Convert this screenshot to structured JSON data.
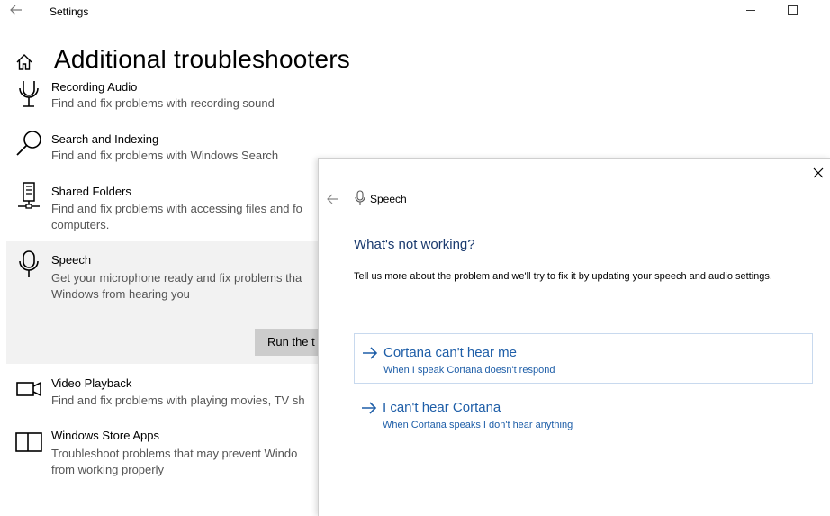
{
  "window": {
    "title": "Settings"
  },
  "page": {
    "title": "Additional troubleshooters"
  },
  "items": [
    {
      "name": "Recording Audio",
      "desc": "Find and fix problems with recording sound",
      "icon": "microphone-icon"
    },
    {
      "name": "Search and Indexing",
      "desc": "Find and fix problems with Windows Search",
      "icon": "search-icon"
    },
    {
      "name": "Shared Folders",
      "desc": "Find and fix problems with accessing files and fo computers.",
      "icon": "shared-folders-icon"
    },
    {
      "name": "Speech",
      "desc": "Get your microphone ready and fix problems tha Windows from hearing you",
      "icon": "microphone-icon",
      "run_label": "Run the t"
    },
    {
      "name": "Video Playback",
      "desc": "Find and fix problems with playing movies, TV sh",
      "icon": "video-camera-icon"
    },
    {
      "name": "Windows Store Apps",
      "desc": "Troubleshoot problems that may prevent Windo from working properly",
      "icon": "store-apps-icon"
    }
  ],
  "dialog": {
    "title": "Speech",
    "heading": "What's not working?",
    "text": "Tell us more about the problem and we'll try to fix it by updating your speech and audio settings.",
    "options": [
      {
        "title": "Cortana can't hear me",
        "subtitle": "When I speak Cortana doesn't respond"
      },
      {
        "title": "I can't hear Cortana",
        "subtitle": "When Cortana speaks I don't hear anything"
      }
    ]
  },
  "colors": {
    "accent": "#1e5ea8",
    "heading": "#1a3a6e",
    "selected_bg": "#f2f2f2",
    "button_bg": "#cccccc"
  }
}
